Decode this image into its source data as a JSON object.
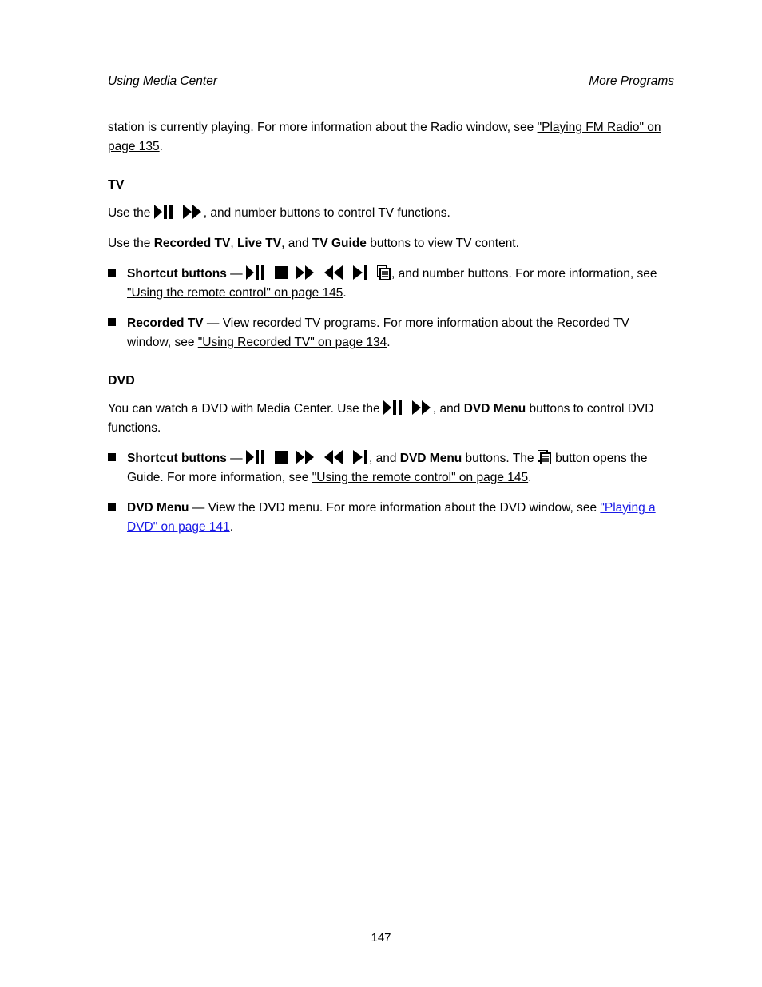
{
  "header": {
    "left": "Using Media Center",
    "right": "More Programs"
  },
  "intro": {
    "part1": "station is currently playing. For more information about the Radio window, see ",
    "linkText": "\"Playing FM Radio\" on page 135",
    "part2": "."
  },
  "tvSection": {
    "title": "TV",
    "intro": {
      "pre": "Use the ",
      "buttonsSuffix": ", and number buttons to control TV functions.",
      "line2a": "Use the ",
      "bold1": "Recorded TV",
      "line2b": ", ",
      "bold2": "Live TV",
      "line2c": ", and ",
      "bold3": "TV Guide",
      "line2d": " buttons to view TV content."
    },
    "bullets": [
      {
        "label": "Shortcut buttons",
        "text1": "— ",
        "text2": ", and number buttons. For more information, see ",
        "linkText": "\"Using the remote control\" on page 145",
        "text3": "."
      },
      {
        "label": "Recorded TV",
        "text1": " — View recorded TV programs. For more information about the Recorded TV window, see ",
        "linkText": "\"Using Recorded TV\" on page 134",
        "text2": "."
      }
    ]
  },
  "dvdSection": {
    "title": "DVD",
    "intro": {
      "line1a": "You can watch a DVD with Media Center. Use the ",
      "line1b": ", and ",
      "bold1": "DVD Menu",
      "line1c": " buttons to control DVD functions."
    },
    "bullets": [
      {
        "label": "Shortcut buttons",
        "text1": "— ",
        "text2": ", and ",
        "bold1": "DVD Menu",
        "text3": " buttons. The ",
        "text4": " button opens the Guide. For more information, see ",
        "linkText": "\"Using the remote control\" on page 145",
        "text5": "."
      },
      {
        "label": "DVD Menu",
        "text1": " — View the DVD menu. For more information about the DVD window, see ",
        "linkText": "\"Playing a DVD\" on page 141",
        "text2": "."
      }
    ]
  },
  "icons": {
    "playpause": "play-pause-icon",
    "stop": "stop-icon",
    "ffwd": "fast-forward-icon",
    "rwd": "rewind-icon",
    "next": "next-icon",
    "guide": "guide-icon"
  },
  "footer": {
    "page": "147"
  }
}
